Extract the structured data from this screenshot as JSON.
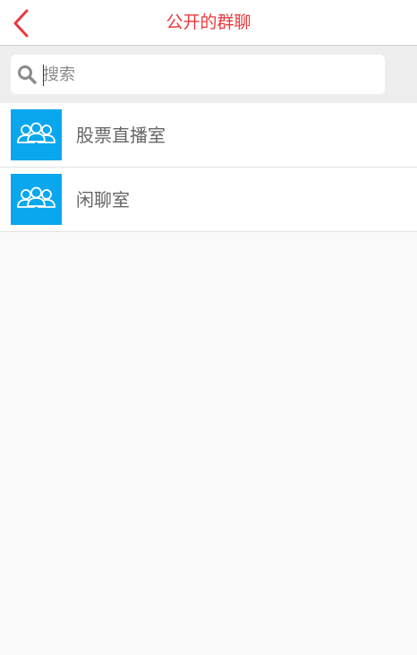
{
  "header": {
    "title": "公开的群聊",
    "title_color": "#e8383d",
    "back_icon": "chevron-left-icon"
  },
  "search": {
    "placeholder": "搜索",
    "value": "",
    "icon": "search-icon"
  },
  "groups": [
    {
      "name": "股票直播室",
      "icon": "group-icon",
      "icon_bg": "#0aa7ef"
    },
    {
      "name": "闲聊室",
      "icon": "group-icon",
      "icon_bg": "#0aa7ef"
    }
  ]
}
